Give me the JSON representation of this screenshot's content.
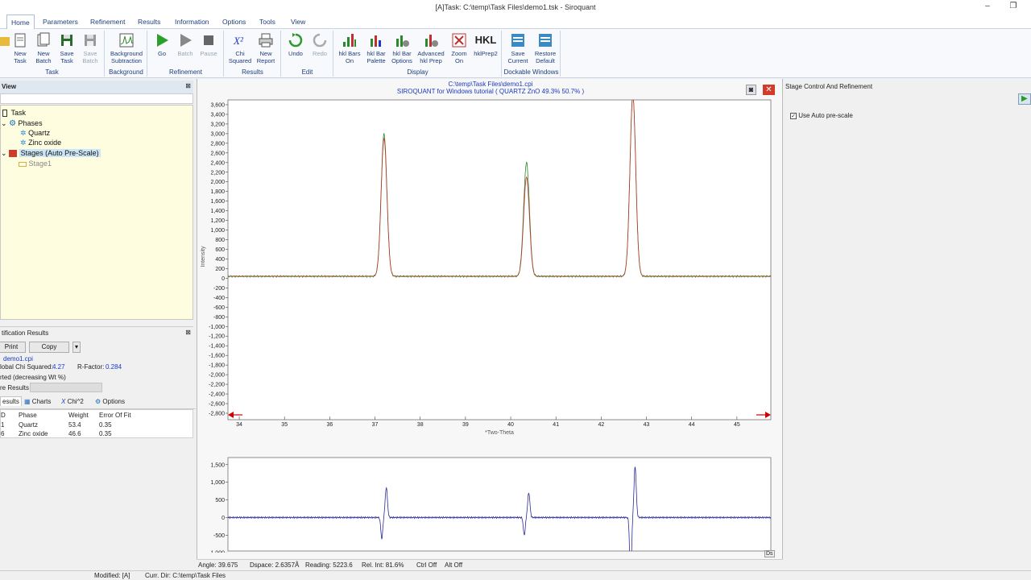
{
  "window": {
    "title": "[A]Task: C:\\temp\\Task Files\\demo1.tsk - Siroquant"
  },
  "menu": {
    "home": "Home",
    "parameters": "Parameters",
    "refinement": "Refinement",
    "results": "Results",
    "information": "Information",
    "options": "Options",
    "tools": "Tools",
    "view": "View"
  },
  "ribbon": {
    "task": {
      "label": "Task",
      "new_task": "New\nTask",
      "new_batch": "New\nBatch",
      "save_task": "Save\nTask",
      "save_batch": "Save\nBatch"
    },
    "background": {
      "label": "Background",
      "bg_sub": "Background\nSubtraction"
    },
    "refinement": {
      "label": "Refinement",
      "go": "Go",
      "batch": "Batch",
      "pause": "Pause"
    },
    "results": {
      "label": "Results",
      "chi": "Chi\nSquared",
      "new_report": "New\nReport"
    },
    "edit": {
      "label": "Edit",
      "undo": "Undo",
      "redo": "Redo"
    },
    "display": {
      "label": "Display",
      "hkl_bars": "hkl Bars\nOn",
      "hkl_palette": "hkl Bar\nPalette",
      "hkl_options": "hkl Bar\nOptions",
      "adv_hkl": "Advanced\nhkl Prep",
      "zoom": "Zoom\nOn",
      "hklprep2": "hklPrep2",
      "hkl_text": "HKL"
    },
    "dockable": {
      "label": "Dockable Windows",
      "save_current": "Save\nCurrent",
      "restore_default": "Restore\nDefault"
    }
  },
  "left": {
    "view_title": "View",
    "tree": {
      "task": "Task",
      "phases": "Phases",
      "quartz": "Quartz",
      "zinc": "Zinc oxide",
      "stages": "Stages (Auto Pre-Scale)",
      "stage1": "Stage1"
    },
    "results_title": "tification Results",
    "print": "Print",
    "copy": "Copy",
    "file": "demo1.cpi",
    "chi_label": "lobal Chi Squared:",
    "chi_value": "4.27",
    "rfactor_label": "R-Factor:",
    "rfactor_value": "0.284",
    "sorted": "rted (decreasing Wt %)",
    "more_results": "re Results",
    "tabs": {
      "results": "esults",
      "charts": "Charts",
      "chi2": "Chi^2",
      "options": "Options"
    },
    "table": {
      "headers": [
        "D",
        "Phase",
        "Weight",
        "Error Of Fit"
      ],
      "rows": [
        [
          "1",
          "Quartz",
          "53.4",
          "0.35"
        ],
        [
          "6",
          "Zinc oxide",
          "46.6",
          "0.35"
        ]
      ]
    }
  },
  "center": {
    "path": "C:\\temp\\Task Files\\demo1.cpi",
    "subtitle": "SIROQUANT for Windows tutorial ( QUARTZ ZnO 49.3% 50.7% )",
    "ds": "Ds"
  },
  "chart_data": [
    {
      "type": "line",
      "title": "SIROQUANT for Windows tutorial ( QUARTZ ZnO 49.3% 50.7% )",
      "xlabel": "*Two-Theta",
      "ylabel": "Intensity",
      "xlim": [
        33.75,
        45.75
      ],
      "ylim": [
        -2800,
        3700
      ],
      "xticks": [
        34,
        35,
        36,
        37,
        38,
        39,
        40,
        41,
        42,
        43,
        44,
        45
      ],
      "yticks": [
        3600,
        3400,
        3200,
        3000,
        2800,
        2600,
        2400,
        2200,
        2000,
        1800,
        1600,
        1400,
        1200,
        1000,
        800,
        600,
        400,
        200,
        0,
        -200,
        -400,
        -600,
        -800,
        -1000,
        -1200,
        -1400,
        -1600,
        -1800,
        -2000,
        -2200,
        -2400,
        -2600,
        -2800
      ],
      "ytick_labels": [
        "3,600",
        "3,400",
        "3,200",
        "3,000",
        "2,800",
        "2,600",
        "2,400",
        "2,200",
        "2,000",
        "1,800",
        "1,600",
        "1,400",
        "1,200",
        "1,000",
        "800",
        "600",
        "400",
        "200",
        "0",
        "-200",
        "-400",
        "-600",
        "-800",
        "-1,000",
        "-1,200",
        "-1,400",
        "-1,600",
        "-1,800",
        "-2,000",
        "-2,200",
        "-2,400",
        "-2,600",
        "-2,800"
      ],
      "colors": {
        "observed": "#2c8a2c",
        "calculated": "#c0392b",
        "marker": "#d00000"
      },
      "peaks": [
        {
          "x": 37.2,
          "obs": 3000,
          "calc": 2900
        },
        {
          "x": 40.35,
          "obs": 2400,
          "calc": 2100
        },
        {
          "x": 42.7,
          "obs": 3800,
          "calc": 3800
        }
      ],
      "baseline": 40
    },
    {
      "type": "line",
      "title": "",
      "ylim": [
        -950,
        1700
      ],
      "yticks": [
        1500,
        1000,
        500,
        0,
        -500,
        -1000
      ],
      "ytick_labels": [
        "1,500",
        "1,000",
        "500",
        "0",
        "-500",
        "-1,000"
      ],
      "colors": {
        "difference": "#2a2a9a"
      },
      "features": [
        {
          "x": 37.2,
          "min": -600,
          "max": 850
        },
        {
          "x": 40.35,
          "min": -500,
          "max": 700
        },
        {
          "x": 42.7,
          "min": -1750,
          "max": 1450
        }
      ]
    }
  ],
  "right": {
    "title": "Stage Control And Refinement",
    "auto_prescale": "Use Auto pre-scale"
  },
  "status": {
    "angle": "Angle: 39.675",
    "dspace": "Dspace: 2.6357Å",
    "reading": "Reading: 5223.6",
    "relint": "Rel. Int: 81.6%",
    "ctrl": "Ctrl Off",
    "alt": "Alt Off",
    "modified": "Modified: [A]",
    "curdir": "Curr. Dir: C:\\temp\\Task Files"
  }
}
